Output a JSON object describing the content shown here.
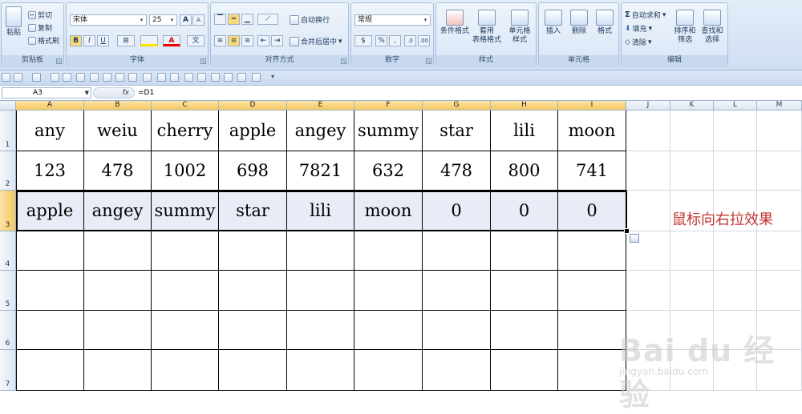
{
  "ribbon": {
    "clipboard": {
      "paste": "粘贴",
      "cut": "剪切",
      "copy": "复制",
      "format_painter": "格式刷",
      "label": "剪贴板"
    },
    "font": {
      "name": "宋体",
      "size": "25",
      "increase": "A",
      "decrease": "A",
      "bold": "B",
      "italic": "I",
      "underline": "U",
      "label": "字体"
    },
    "alignment": {
      "wrap": "自动换行",
      "merge": "合并后居中",
      "label": "对齐方式"
    },
    "number": {
      "format": "常规",
      "percent": "%",
      "comma": ",",
      "label": "数字"
    },
    "styles": {
      "conditional": "条件格式",
      "table_line1": "套用",
      "table_line2": "表格格式",
      "cell_line1": "单元格",
      "cell_line2": "样式",
      "label": "样式"
    },
    "cells": {
      "insert": "插入",
      "delete": "删除",
      "format": "格式",
      "label": "单元格"
    },
    "editing": {
      "autosum": "自动求和",
      "fill": "填充",
      "clear": "清除",
      "sort_line1": "排序和",
      "sort_line2": "筛选",
      "find_line1": "查找和",
      "find_line2": "选择",
      "label": "编辑"
    }
  },
  "formula_bar": {
    "name_box": "A3",
    "fx": "fx",
    "formula": "=D1"
  },
  "columns": [
    "A",
    "B",
    "C",
    "D",
    "E",
    "F",
    "G",
    "H",
    "I",
    "J",
    "K",
    "L",
    "M"
  ],
  "rows": [
    "1",
    "2",
    "3",
    "4",
    "5",
    "6",
    "7"
  ],
  "grid": [
    [
      "any",
      "weiu",
      "cherry",
      "apple",
      "angey",
      "summy",
      "star",
      "lili",
      "moon"
    ],
    [
      "123",
      "478",
      "1002",
      "698",
      "7821",
      "632",
      "478",
      "800",
      "741"
    ],
    [
      "apple",
      "angey",
      "summy",
      "star",
      "lili",
      "moon",
      "0",
      "0",
      "0"
    ]
  ],
  "annotation": "鼠标向右拉效果",
  "watermark": {
    "main": "Bai du 经验",
    "sub": "jingyan.baidu.com"
  }
}
